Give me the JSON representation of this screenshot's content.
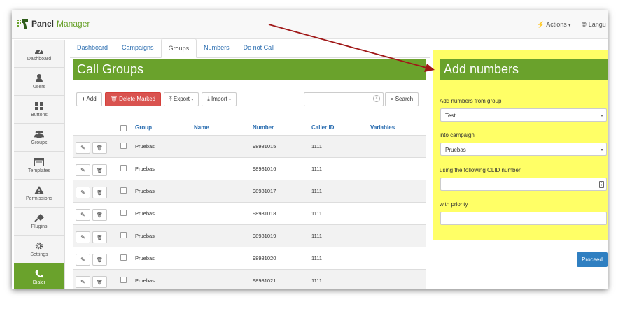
{
  "brand": {
    "word1": "Panel",
    "word2": "Manager"
  },
  "navbar": {
    "actions": "Actions",
    "language": "Langu"
  },
  "sidebar": {
    "items": [
      {
        "label": "Dashboard",
        "icon": "dashboard-icon"
      },
      {
        "label": "Users",
        "icon": "user-icon"
      },
      {
        "label": "Buttons",
        "icon": "grid-icon"
      },
      {
        "label": "Groups",
        "icon": "group-icon"
      },
      {
        "label": "Templates",
        "icon": "template-icon"
      },
      {
        "label": "Permissions",
        "icon": "warning-icon"
      },
      {
        "label": "Plugins",
        "icon": "plug-icon"
      },
      {
        "label": "Settings",
        "icon": "gear-icon"
      },
      {
        "label": "Dialer",
        "icon": "phone-icon"
      }
    ]
  },
  "tabs": [
    "Dashboard",
    "Campaigns",
    "Groups",
    "Numbers",
    "Do not Call"
  ],
  "active_tab": "Groups",
  "left_panel": {
    "title": "Call Groups"
  },
  "toolbar": {
    "add": "Add",
    "delete": "Delete Marked",
    "export": "Export",
    "import": "Import",
    "search_btn": "Search",
    "search_value": ""
  },
  "table": {
    "headers": [
      "Group",
      "Name",
      "Number",
      "Caller ID",
      "Variables"
    ],
    "rows": [
      {
        "group": "Pruebas",
        "name": "",
        "number": "98981015",
        "caller_id": "1111",
        "variables": ""
      },
      {
        "group": "Pruebas",
        "name": "",
        "number": "98981016",
        "caller_id": "1111",
        "variables": ""
      },
      {
        "group": "Pruebas",
        "name": "",
        "number": "98981017",
        "caller_id": "1111",
        "variables": ""
      },
      {
        "group": "Pruebas",
        "name": "",
        "number": "98981018",
        "caller_id": "1111",
        "variables": ""
      },
      {
        "group": "Pruebas",
        "name": "",
        "number": "98981019",
        "caller_id": "1111",
        "variables": ""
      },
      {
        "group": "Pruebas",
        "name": "",
        "number": "98981020",
        "caller_id": "1111",
        "variables": ""
      },
      {
        "group": "Pruebas",
        "name": "",
        "number": "98981021",
        "caller_id": "1111",
        "variables": ""
      }
    ]
  },
  "right_panel": {
    "title": "Add numbers",
    "from_group_label": "Add numbers from group",
    "from_group_value": "Test",
    "campaign_label": "into campaign",
    "campaign_value": "Pruebas",
    "clid_label": "using the following CLID number",
    "clid_value": "",
    "priority_label": "with priority",
    "priority_value": "",
    "proceed": "Proceed"
  },
  "colors": {
    "green": "#6aa22c",
    "highlight": "#ffff66",
    "link": "#2a6db0",
    "danger": "#d9534f",
    "primary": "#2f7fc1",
    "arrow": "#a01818"
  }
}
